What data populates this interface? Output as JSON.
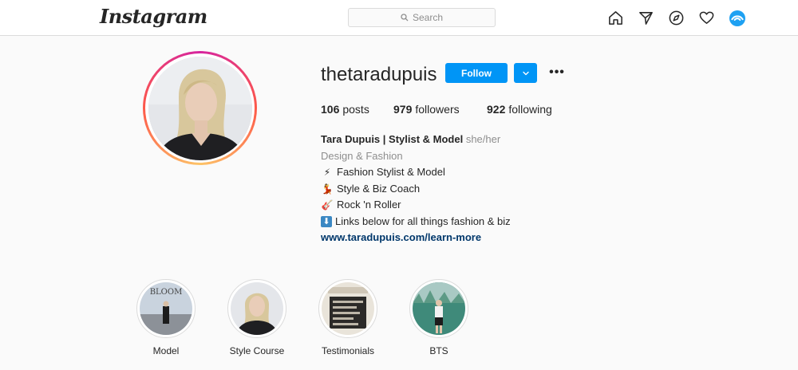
{
  "header": {
    "logo_text": "Instagram",
    "search_placeholder": "Search",
    "nav_icons": [
      "home-icon",
      "direct-message-icon",
      "explore-icon",
      "activity-heart-icon",
      "profile-avatar"
    ]
  },
  "profile": {
    "username": "thetaradupuis",
    "follow_label": "Follow",
    "more_label": "•••",
    "stats": {
      "posts_count": "106",
      "posts_label": "posts",
      "followers_count": "979",
      "followers_label": "followers",
      "following_count": "922",
      "following_label": "following"
    },
    "bio": {
      "name": "Tara Dupuis | Stylist & Model",
      "pronouns": "she/her",
      "category": "Design & Fashion",
      "lines": [
        {
          "emoji": "⚡",
          "text": "Fashion Stylist & Model"
        },
        {
          "emoji": "💃",
          "text": "Style & Biz Coach"
        },
        {
          "emoji": "🎸",
          "text": "Rock 'n Roller"
        },
        {
          "emoji": "⬇",
          "text": "Links below for all things fashion & biz"
        }
      ],
      "link": "www.taradupuis.com/learn-more"
    }
  },
  "highlights": [
    {
      "label": "Model"
    },
    {
      "label": "Style Course"
    },
    {
      "label": "Testimonials"
    },
    {
      "label": "BTS"
    }
  ],
  "colors": {
    "accent_blue": "#0095f6",
    "link_blue": "#00376b",
    "background": "#fafafa",
    "border": "#dbdbdb"
  }
}
